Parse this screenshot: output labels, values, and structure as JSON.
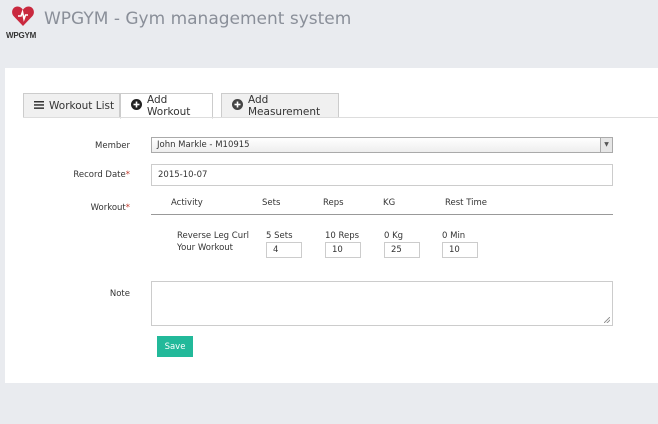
{
  "header": {
    "logo_text": "WPGYM",
    "title": "WPGYM - Gym management system"
  },
  "tabs": [
    {
      "label": "Workout List",
      "icon": "list-icon"
    },
    {
      "label": "Add Workout",
      "icon": "plus-circle-icon"
    },
    {
      "label": "Add Measurement",
      "icon": "plus-circle-icon"
    }
  ],
  "form": {
    "member_label": "Member",
    "member_value": "John Markle - M10915",
    "record_date_label": "Record Date",
    "record_date_value": "2015-10-07",
    "workout_label": "Workout",
    "required_mark": "*",
    "note_label": "Note",
    "note_value": "",
    "save_label": "Save"
  },
  "workout_table": {
    "headers": [
      "Activity",
      "Sets",
      "Reps",
      "KG",
      "Rest Time"
    ],
    "row": {
      "activity_line1": "Reverse Leg Curl",
      "activity_line2": "Your Workout",
      "sets_text": "5 Sets",
      "sets_value": "4",
      "reps_text": "10 Reps",
      "reps_value": "10",
      "kg_text": "0 Kg",
      "kg_value": "25",
      "rest_text": "0 Min",
      "rest_value": "10"
    }
  },
  "colors": {
    "accent": "#22b99a",
    "required": "#c0392b",
    "logo": "#c9283e"
  }
}
